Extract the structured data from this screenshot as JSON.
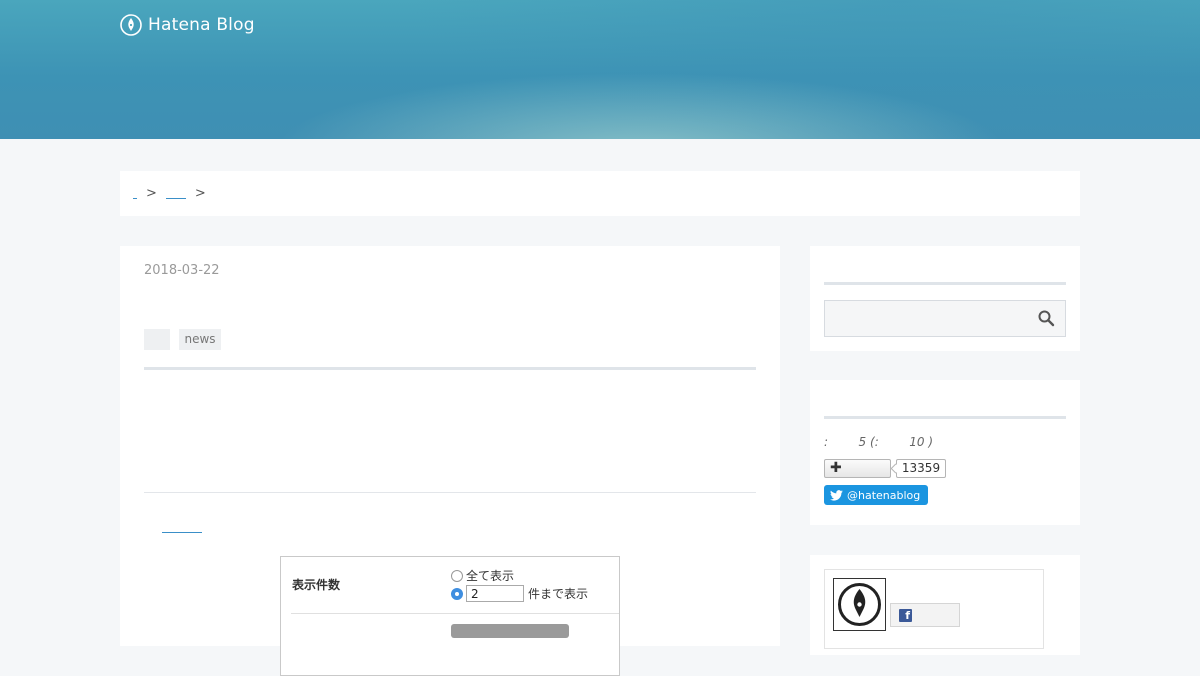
{
  "header": {
    "logo_text": "Hatena Blog"
  },
  "breadcrumb": {
    "separator": ">"
  },
  "entry": {
    "date": "2018-03-22",
    "tags": [
      "",
      "news"
    ]
  },
  "display_settings": {
    "label": "表示件数",
    "option_all": "全て表示",
    "count_value": "2",
    "count_suffix": "件まで表示"
  },
  "sidebar": {
    "readers_line": ":        5 (:        10 )",
    "follow_count": "13359",
    "twitter_handle": "@hatenablog"
  },
  "colors": {
    "header_blue": "#3f8fb3",
    "link_blue": "#3a8fc8",
    "twitter_blue": "#1b95e0",
    "facebook_blue": "#3b5998",
    "radio_blue": "#3f8ee0"
  },
  "icons": {
    "logo": "pen-nib-icon",
    "search": "search-icon",
    "follow": "plus-icon",
    "twitter": "twitter-bird-icon",
    "facebook": "facebook-icon"
  }
}
